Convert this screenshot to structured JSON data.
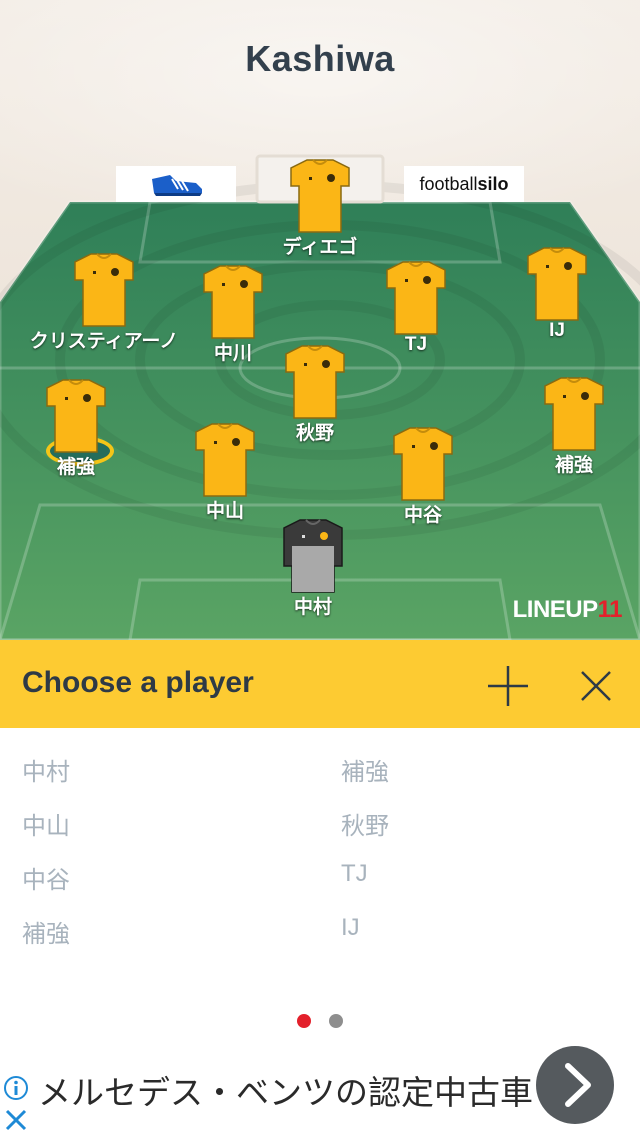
{
  "team": {
    "name": "Kashiwa"
  },
  "sponsors": {
    "left_icon": "boot-icon",
    "right_text_light": "football",
    "right_text_bold": "silo"
  },
  "players_on_pitch": [
    {
      "name": "ディエゴ",
      "kit": "yellow"
    },
    {
      "name": "クリスティアーノ",
      "kit": "yellow"
    },
    {
      "name": "中川",
      "kit": "yellow"
    },
    {
      "name": "TJ",
      "kit": "yellow"
    },
    {
      "name": "IJ",
      "kit": "yellow"
    },
    {
      "name": "秋野",
      "kit": "yellow"
    },
    {
      "name": "補強",
      "kit": "yellow",
      "selected": true
    },
    {
      "name": "補強",
      "kit": "yellow"
    },
    {
      "name": "中山",
      "kit": "yellow"
    },
    {
      "name": "中谷",
      "kit": "yellow"
    },
    {
      "name": "中村",
      "kit": "goalkeeper"
    }
  ],
  "brand": {
    "text": "LINEUP",
    "number": "11"
  },
  "chooser": {
    "title": "Choose a player",
    "add_icon": "plus-icon",
    "close_icon": "close-icon"
  },
  "player_list": {
    "left": [
      "中村",
      "中山",
      "中谷",
      "補強"
    ],
    "right": [
      "補強",
      "秋野",
      "TJ",
      "IJ"
    ]
  },
  "pagination": {
    "total": 2,
    "active": 1
  },
  "colors": {
    "kit_yellow": "#fbb616",
    "accent_yellow": "#fdcb32",
    "dot_active": "#e3202b",
    "dot_inactive": "#8e8e8e",
    "title_dark": "#33404d"
  },
  "ad": {
    "text": "メルセデス・ベンツの認定中古車"
  }
}
